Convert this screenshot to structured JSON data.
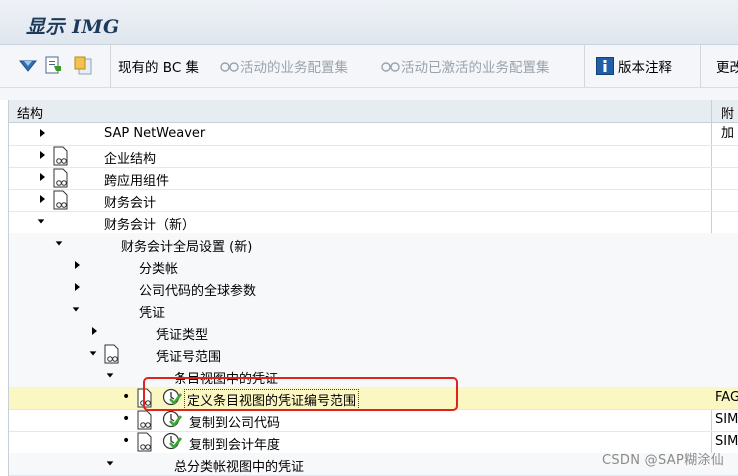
{
  "window": {
    "title": "显示 IMG"
  },
  "toolbar": {
    "btn_existing_bc": "现有的 BC 集",
    "btn_active_bc": "活动的业务配置集",
    "btn_activated_bc": "活动已激活的业务配置集",
    "btn_release_notes": "版本注释",
    "btn_more": "更改"
  },
  "table": {
    "col_structure": "结构",
    "col_additional": "附加",
    "rows": [
      {
        "label": "SAP NetWeaver",
        "extra": ""
      },
      {
        "label": "企业结构",
        "extra": ""
      },
      {
        "label": "跨应用组件",
        "extra": ""
      },
      {
        "label": "财务会计",
        "extra": ""
      },
      {
        "label": "财务会计（新）",
        "extra": ""
      },
      {
        "label": "财务会计全局设置 (新)",
        "extra": ""
      },
      {
        "label": "分类帐",
        "extra": ""
      },
      {
        "label": "公司代码的全球参数",
        "extra": ""
      },
      {
        "label": "凭证",
        "extra": ""
      },
      {
        "label": "凭证类型",
        "extra": ""
      },
      {
        "label": "凭证号范围",
        "extra": ""
      },
      {
        "label": "条目视图中的凭证",
        "extra": ""
      },
      {
        "label": "定义条目视图的凭证编号范围",
        "extra": "FAG"
      },
      {
        "label": "复制到公司代码",
        "extra": "SIM"
      },
      {
        "label": "复制到会计年度",
        "extra": "SIM"
      },
      {
        "label": "总分类帐视图中的凭证",
        "extra": ""
      }
    ]
  },
  "watermark": "CSDN @SAP糊涂仙"
}
